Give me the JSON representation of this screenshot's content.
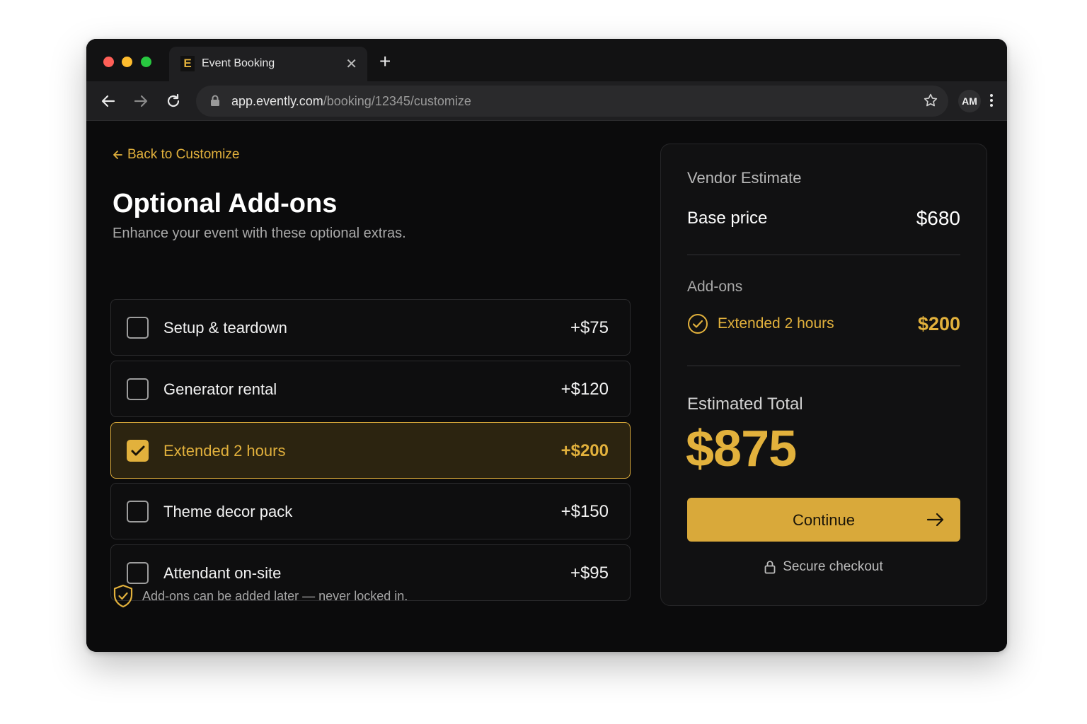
{
  "browser": {
    "tab_title": "Event Booking",
    "favicon_letter": "E",
    "url_host": "app.evently.com",
    "url_path": "/booking/12345/customize",
    "profile_initials": "AM"
  },
  "page": {
    "back_link": "Back to Customize",
    "title": "Optional Add-ons",
    "subtitle": "Enhance your event with these optional extras.",
    "addons": [
      {
        "label": "Setup & teardown",
        "price": "+$75",
        "selected": false
      },
      {
        "label": "Generator rental",
        "price": "+$120",
        "selected": false
      },
      {
        "label": "Extended 2 hours",
        "price": "+$200",
        "selected": true
      },
      {
        "label": "Theme decor pack",
        "price": "+$150",
        "selected": false
      },
      {
        "label": "Attendant on-site",
        "price": "+$95",
        "selected": false
      }
    ],
    "note": "Add-ons can be added later — never locked in."
  },
  "summary": {
    "heading": "Vendor Estimate",
    "base_label": "Base price",
    "base_value": "$680",
    "addons_heading": "Add-ons",
    "addon_label": "Extended 2 hours",
    "addon_value": "$200",
    "total_label": "Estimated Total",
    "total_value": "$875",
    "continue_label": "Continue",
    "secure_label": "Secure checkout"
  },
  "colors": {
    "accent": "#e2b13c",
    "background": "#0b0b0c",
    "panel": "#111112"
  }
}
